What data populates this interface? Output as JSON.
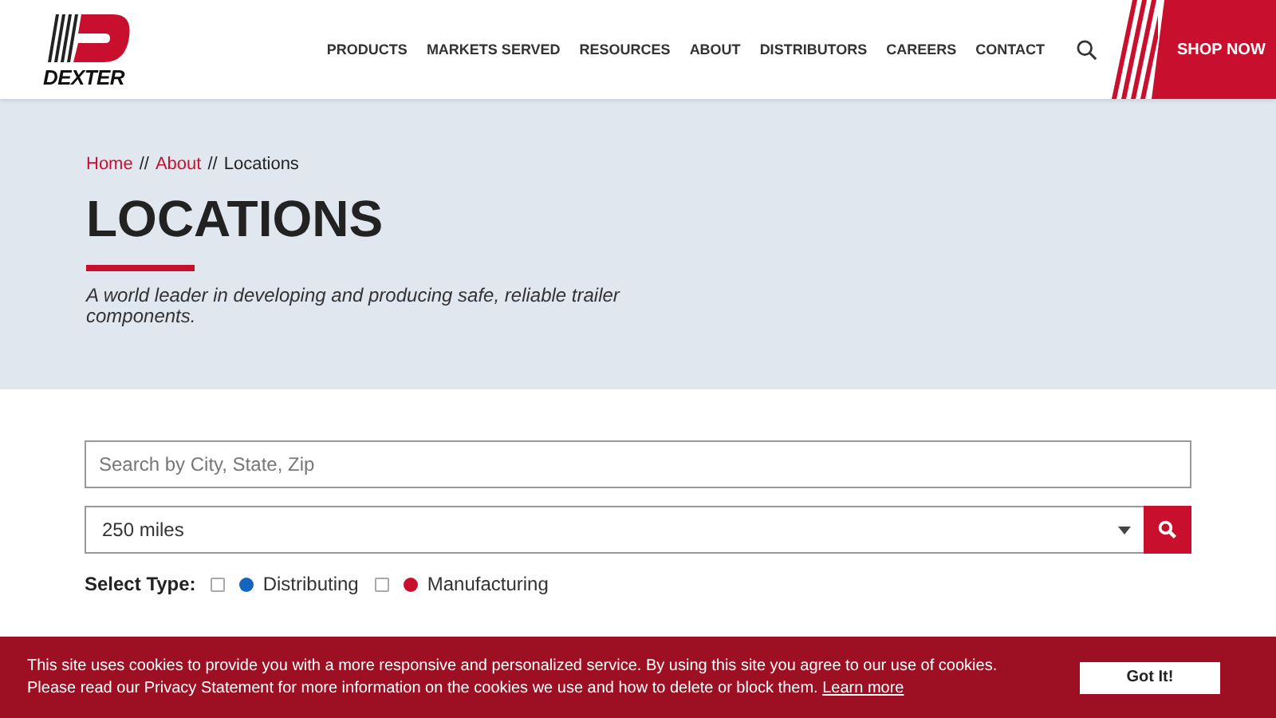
{
  "header": {
    "logo_text": "DEXTER",
    "nav": [
      "PRODUCTS",
      "MARKETS SERVED",
      "RESOURCES",
      "ABOUT",
      "DISTRIBUTORS",
      "CAREERS",
      "CONTACT"
    ],
    "shop_button": "SHOP NOW"
  },
  "breadcrumb": {
    "links": [
      "Home",
      "About"
    ],
    "separator": "//",
    "current": "Locations"
  },
  "hero": {
    "title": "LOCATIONS",
    "subtitle": "A world leader in developing and producing safe, reliable trailer components."
  },
  "search": {
    "placeholder": "Search by City, State, Zip"
  },
  "radius": {
    "value": "250 miles"
  },
  "filter": {
    "label": "Select Type:",
    "types": [
      {
        "label": "Distributing",
        "checked": false,
        "color": "#1565c0"
      },
      {
        "label": "Manufacturing",
        "checked": false,
        "color": "#c8102e"
      }
    ]
  },
  "cookie_banner": {
    "text": "This site uses cookies to provide you with a more responsive and personalized service. By using this site you agree to our use of cookies. Please read our Privacy Statement for more information on the cookies we use and how to delete or block them.",
    "link": "Learn more",
    "button": "Got It!"
  }
}
